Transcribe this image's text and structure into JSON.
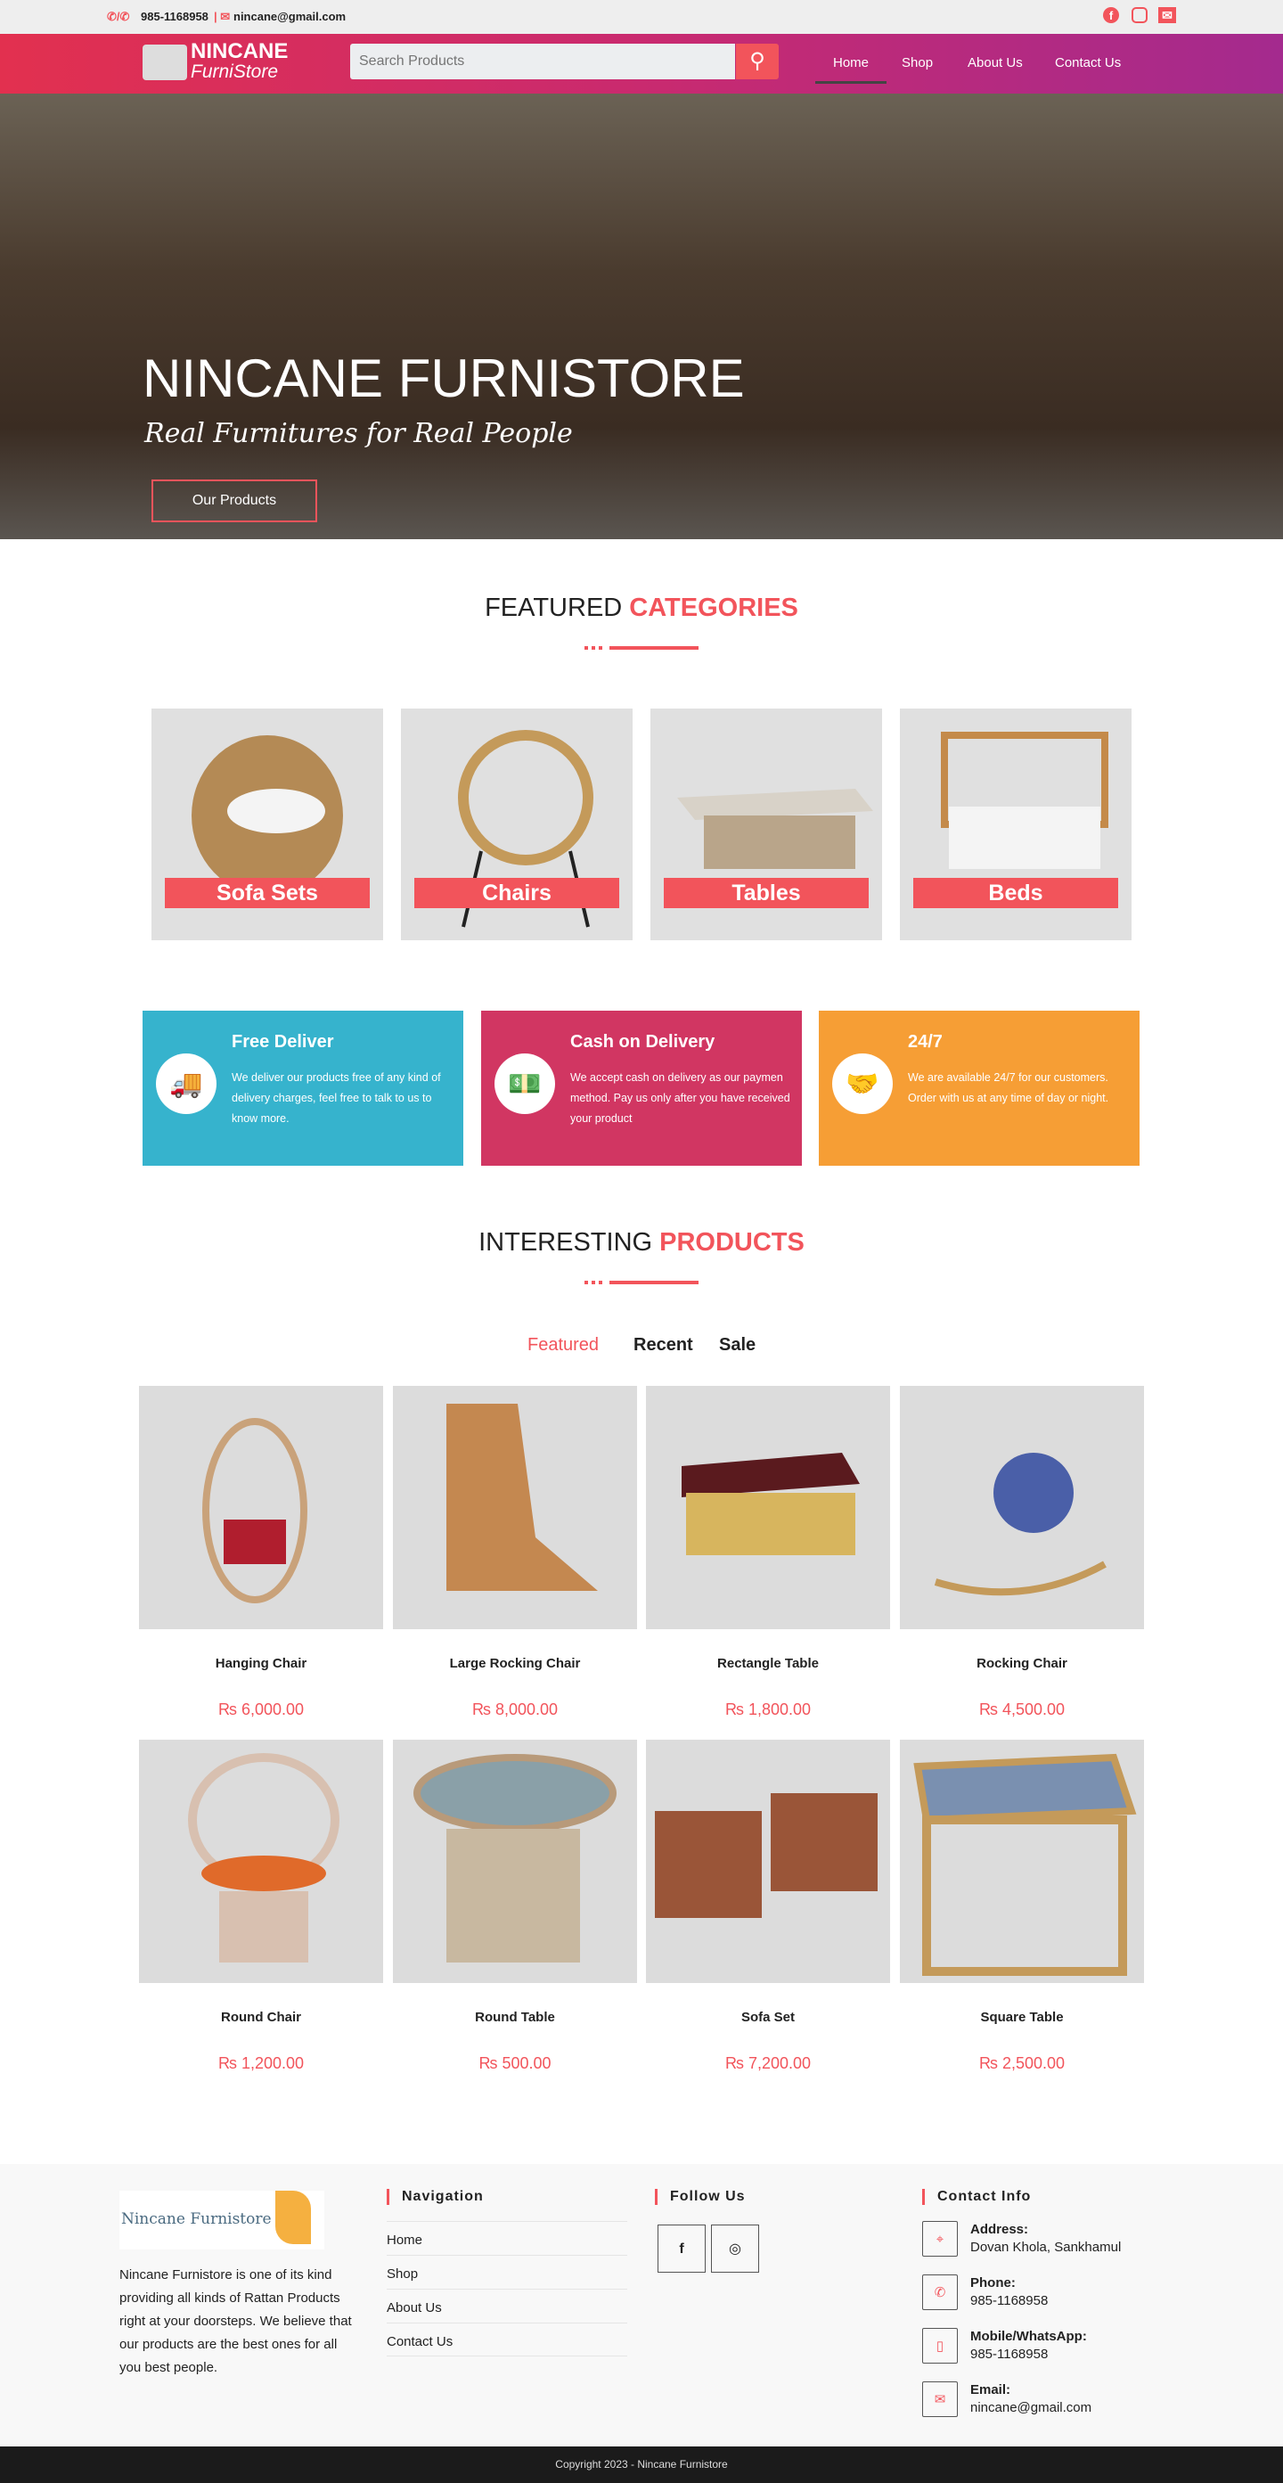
{
  "topbar": {
    "phone": "985-1168958",
    "email": "nincane@gmail.com",
    "social_icons": [
      "facebook-icon",
      "instagram-icon",
      "email-icon"
    ]
  },
  "header": {
    "logo_line1": "NINCANE",
    "logo_line2": "FurniStore",
    "search_placeholder": "Search Products",
    "nav": [
      "Home",
      "Shop",
      "About Us",
      "Contact Us"
    ],
    "active": "Home"
  },
  "hero": {
    "title": "NINCANE FURNISTORE",
    "subtitle": "Real Furnitures for Real People",
    "button": "Our Products"
  },
  "categories": {
    "title_a": "FEATURED",
    "title_b": "CATEGORIES",
    "items": [
      "Sofa Sets",
      "Chairs",
      "Tables",
      "Beds"
    ]
  },
  "features": [
    {
      "title": "Free Deliver",
      "text": "We deliver our products free of any kind of delivery charges, feel free to talk to us to know more.",
      "color": "#36b3cd",
      "icon": "truck-icon"
    },
    {
      "title": "Cash on Delivery",
      "text": "We accept cash on delivery as our paymen method. Pay us only after you have received your product",
      "color": "#d13662",
      "icon": "money-icon"
    },
    {
      "title": "24/7",
      "text": "We are available 24/7 for our customers. Order with us at any time of day or night.",
      "color": "#f69e35",
      "icon": "handshake-icon"
    }
  ],
  "products": {
    "title_a": "INTERESTING",
    "title_b": "PRODUCTS",
    "tabs": [
      "Featured",
      "Recent",
      "Sale"
    ],
    "active_tab": "Featured",
    "items": [
      {
        "name": "Hanging Chair",
        "price": "₨ 6,000.00"
      },
      {
        "name": "Large Rocking Chair",
        "price": "₨ 8,000.00"
      },
      {
        "name": "Rectangle Table",
        "price": "₨ 1,800.00"
      },
      {
        "name": "Rocking Chair",
        "price": "₨ 4,500.00"
      },
      {
        "name": "Round Chair",
        "price": "₨ 1,200.00"
      },
      {
        "name": "Round Table",
        "price": "₨ 500.00"
      },
      {
        "name": "Sofa Set",
        "price": "₨ 7,200.00"
      },
      {
        "name": "Square Table",
        "price": "₨ 2,500.00"
      }
    ]
  },
  "footer": {
    "logo_text": "Nincane Furnistore",
    "about": "Nincane Furnistore is one of its kind providing all kinds of Rattan Products right at your doorsteps. We believe that our products are the best ones for all you best people.",
    "nav_title": "Navigation",
    "nav": [
      "Home",
      "Shop",
      "About Us",
      "Contact Us"
    ],
    "follow_title": "Follow Us",
    "contact_title": "Contact Info",
    "contacts": [
      {
        "label": "Address:",
        "value": "Dovan Khola, Sankhamul"
      },
      {
        "label": "Phone:",
        "value": "985-1168958"
      },
      {
        "label": "Mobile/WhatsApp:",
        "value": "985-1168958"
      },
      {
        "label": "Email:",
        "value": "nincane@gmail.com"
      }
    ],
    "copyright": "Copyright 2023 - Nincane Furnistore"
  },
  "colors": {
    "accent": "#f2545b",
    "header_start": "#e2304f",
    "header_end": "#a42a8e"
  }
}
